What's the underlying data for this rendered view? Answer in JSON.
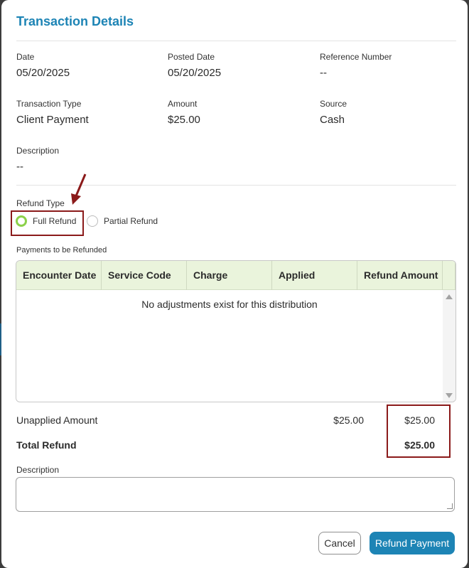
{
  "modal": {
    "title": "Transaction Details"
  },
  "details": {
    "date_label": "Date",
    "date_value": "05/20/2025",
    "posted_date_label": "Posted Date",
    "posted_date_value": "05/20/2025",
    "reference_label": "Reference Number",
    "reference_value": "--",
    "type_label": "Transaction Type",
    "type_value": "Client Payment",
    "amount_label": "Amount",
    "amount_value": "$25.00",
    "source_label": "Source",
    "source_value": "Cash",
    "description_label": "Description",
    "description_value": "--"
  },
  "refund_type": {
    "label": "Refund Type",
    "options": [
      {
        "label": "Full Refund",
        "selected": true
      },
      {
        "label": "Partial Refund",
        "selected": false
      }
    ]
  },
  "payments_table": {
    "label": "Payments to be Refunded",
    "columns": [
      "Encounter Date",
      "Service Code",
      "Charge",
      "Applied",
      "Refund Amount"
    ],
    "empty_message": "No adjustments exist for this distribution"
  },
  "summary": {
    "unapplied_label": "Unapplied Amount",
    "unapplied_amount": "$25.00",
    "unapplied_refund": "$25.00",
    "total_label": "Total Refund",
    "total_refund": "$25.00"
  },
  "refund_description": {
    "label": "Description",
    "value": ""
  },
  "buttons": {
    "cancel": "Cancel",
    "refund": "Refund Payment"
  },
  "colors": {
    "accent": "#1d84b5",
    "radio_selected": "#8cd14b",
    "table_header": "#eaf4dc",
    "highlight": "#8b1a1a"
  }
}
